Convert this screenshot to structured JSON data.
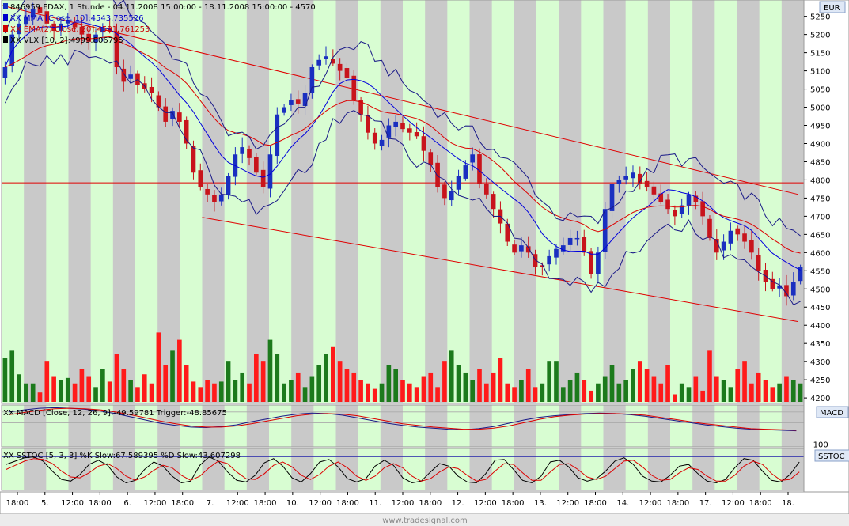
{
  "chart_data": [
    {
      "type": "candlestick",
      "panel": "price",
      "header": [
        {
          "text": "846959 FDAX, 1 Stunde - 04.11.2008 15:00:00 - 18.11.2008 15:00:00 - 4570",
          "color": "#000000"
        },
        {
          "text": "XX MMA [Close, 10]:4543.735526",
          "color": "#0000cc"
        },
        {
          "text": "XX EMA(2) Close, 20]:4581.761253",
          "color": "#cc0000"
        },
        {
          "text": "XX VLX [10, 2]:4999.806795",
          "color": "#000000"
        }
      ],
      "currency_label": "EUR",
      "y_ticks": [
        5250,
        5200,
        5150,
        5100,
        5050,
        5000,
        4950,
        4900,
        4850,
        4800,
        4750,
        4700,
        4650,
        4600,
        4550,
        4500,
        4450,
        4400,
        4350,
        4300,
        4250,
        4200
      ],
      "ylim": [
        4185,
        5295
      ],
      "horizontal_level": 4792,
      "trend_channel": {
        "upper": {
          "from": [
            0.0,
            5280
          ],
          "to": [
            69.5,
            4760
          ]
        },
        "lower": {
          "from": [
            17.5,
            4697
          ],
          "to": [
            69.5,
            4410
          ]
        }
      },
      "close": [
        5110,
        5200,
        5230,
        5250,
        5270,
        5260,
        5230,
        5210,
        5230,
        5240,
        5220,
        5200,
        5180,
        5200,
        5220,
        5210,
        5110,
        5070,
        5090,
        5060,
        5050,
        5040,
        5000,
        4960,
        4990,
        4960,
        4900,
        4820,
        4780,
        4760,
        4740,
        4760,
        4810,
        4870,
        4890,
        4860,
        4820,
        4780,
        4870,
        4980,
        5000,
        5020,
        5010,
        5040,
        5110,
        5130,
        5140,
        5120,
        5100,
        5080,
        5020,
        4980,
        4930,
        4900,
        4910,
        4950,
        4960,
        4940,
        4930,
        4920,
        4880,
        4840,
        4780,
        4750,
        4770,
        4810,
        4840,
        4870,
        4790,
        4760,
        4720,
        4680,
        4630,
        4600,
        4620,
        4600,
        4560,
        4560,
        4590,
        4610,
        4620,
        4640,
        4640,
        4600,
        4540,
        4600,
        4720,
        4790,
        4800,
        4810,
        4820,
        4790,
        4780,
        4760,
        4740,
        4720,
        4700,
        4730,
        4760,
        4740,
        4700,
        4640,
        4600,
        4630,
        4660,
        4650,
        4630,
        4600,
        4550,
        4520,
        4500,
        4510,
        4480,
        4520,
        4560
      ],
      "volume": [
        4310,
        4330,
        4265,
        4240,
        4240,
        4215,
        4300,
        4260,
        4250,
        4255,
        4240,
        4280,
        4260,
        4230,
        4280,
        4245,
        4320,
        4280,
        4250,
        4230,
        4265,
        4240,
        4380,
        4290,
        4330,
        4360,
        4290,
        4245,
        4230,
        4250,
        4240,
        4245,
        4300,
        4250,
        4270,
        4240,
        4320,
        4300,
        4360,
        4320,
        4240,
        4250,
        4270,
        4230,
        4260,
        4290,
        4320,
        4340,
        4300,
        4280,
        4270,
        4250,
        4240,
        4225,
        4240,
        4290,
        4280,
        4250,
        4240,
        4230,
        4260,
        4270,
        4230,
        4300,
        4330,
        4290,
        4270,
        4250,
        4280,
        4240,
        4270,
        4310,
        4240,
        4230,
        4250,
        4280,
        4230,
        4240,
        4300,
        4300,
        4230,
        4250,
        4270,
        4250,
        4220,
        4240,
        4260,
        4290,
        4240,
        4250,
        4280,
        4300,
        4280,
        4260,
        4240,
        4290,
        4210,
        4240,
        4230,
        4260,
        4220,
        4330,
        4260,
        4250,
        4230,
        4280,
        4300,
        4240,
        4270,
        4250,
        4230,
        4240,
        4260,
        4250,
        4240
      ],
      "session_days": [
        "5.",
        "6.",
        "7.",
        "10.",
        "11.",
        "12.",
        "13.",
        "14.",
        "17.",
        "18."
      ],
      "x_labels": [
        "18:00",
        "5.",
        "12:00",
        "18:00",
        "6.",
        "12:00",
        "18:00",
        "7.",
        "12:00",
        "18:00",
        "10.",
        "12:00",
        "18:00",
        "11.",
        "12:00",
        "18:00",
        "12.",
        "12:00",
        "18:00",
        "13.",
        "12:00",
        "18:00",
        "14.",
        "12:00",
        "18:00",
        "17.",
        "12:00",
        "18:00",
        "18."
      ]
    },
    {
      "type": "line",
      "panel": "macd",
      "header": {
        "text": "XX MACD [Close, 12, 26, 9]:-49.59781  Trigger:-48.85675"
      },
      "panel_label": "MACD",
      "y_ticks": [
        -100
      ],
      "series": [
        {
          "values": [
            20,
            28,
            34,
            36,
            34,
            30,
            24,
            14,
            2,
            -10,
            -22,
            -30,
            -36,
            -38,
            -34,
            -28,
            -16,
            -6,
            4,
            12,
            16,
            14,
            8,
            -2,
            -12,
            -22,
            -30,
            -36,
            -40,
            -44,
            -46,
            -42,
            -34,
            -22,
            -10,
            0,
            6,
            10,
            14,
            16,
            14,
            10,
            4,
            -4,
            -12,
            -20,
            -28,
            -34,
            -40,
            -44,
            -46,
            -48,
            -50
          ]
        },
        {
          "values": [
            10,
            18,
            26,
            32,
            34,
            32,
            28,
            20,
            10,
            -2,
            -14,
            -24,
            -32,
            -36,
            -36,
            -32,
            -24,
            -14,
            -4,
            6,
            12,
            14,
            12,
            6,
            -4,
            -14,
            -24,
            -30,
            -36,
            -40,
            -44,
            -44,
            -40,
            -32,
            -20,
            -8,
            2,
            8,
            12,
            14,
            14,
            12,
            8,
            0,
            -8,
            -16,
            -24,
            -30,
            -36,
            -42,
            -44,
            -46,
            -48
          ]
        }
      ],
      "thresholds": [
        20,
        -20
      ]
    },
    {
      "type": "line",
      "panel": "stochastic",
      "header": {
        "text": "XX SSTOC [5, 3, 3] %K Slow:67.589395  %D Slow:43.607298"
      },
      "panel_label": "SSTOC",
      "ylim": [
        0,
        100
      ],
      "thresholds": [
        80,
        20
      ],
      "series": [
        {
          "values": [
            62,
            70,
            78,
            80,
            70,
            46,
            26,
            22,
            38,
            62,
            72,
            60,
            32,
            18,
            24,
            50,
            68,
            58,
            34,
            18,
            22,
            60,
            80,
            70,
            44,
            24,
            20,
            36,
            66,
            76,
            58,
            30,
            20,
            40,
            68,
            74,
            56,
            28,
            20,
            28,
            58,
            72,
            60,
            30,
            18,
            22,
            44,
            64,
            58,
            34,
            20,
            18,
            40,
            72,
            74,
            50,
            24,
            18,
            34,
            68,
            72,
            56,
            30,
            22,
            28,
            46,
            70,
            78,
            62,
            34,
            22,
            20,
            36,
            58,
            62,
            40,
            22,
            18,
            26,
            54,
            76,
            72,
            46,
            24,
            20,
            38,
            68
          ]
        },
        {
          "values": [
            50,
            60,
            70,
            76,
            74,
            64,
            46,
            32,
            30,
            42,
            58,
            64,
            52,
            34,
            24,
            32,
            48,
            60,
            54,
            36,
            24,
            34,
            54,
            70,
            64,
            44,
            28,
            26,
            40,
            60,
            68,
            56,
            36,
            26,
            38,
            58,
            68,
            54,
            34,
            24,
            34,
            54,
            64,
            54,
            34,
            22,
            28,
            44,
            56,
            52,
            36,
            22,
            26,
            46,
            64,
            62,
            42,
            24,
            24,
            44,
            62,
            64,
            50,
            32,
            26,
            34,
            52,
            70,
            72,
            56,
            36,
            24,
            26,
            42,
            54,
            50,
            34,
            22,
            22,
            36,
            58,
            70,
            62,
            40,
            24,
            26,
            44
          ]
        }
      ]
    }
  ],
  "footer": "www.tradesignal.com",
  "colors": {
    "up": "#1a2fc0",
    "down": "#c8141c",
    "vol_up": "#1c7a1c",
    "vol_down": "#ff1a1a",
    "mma": "#0000dd",
    "ema": "#dd0000",
    "vlx": "#1a1a88",
    "channel": "#e00000",
    "band_light": "#d8fdd2",
    "band_gray": "#c9c9c9",
    "macd": "#1a1a88",
    "trigger": "#dd0000",
    "stoch_k": "#000000",
    "stoch_d": "#dd0000",
    "panel_bg": "#ffffff",
    "axis_bg": "#ffffff"
  }
}
